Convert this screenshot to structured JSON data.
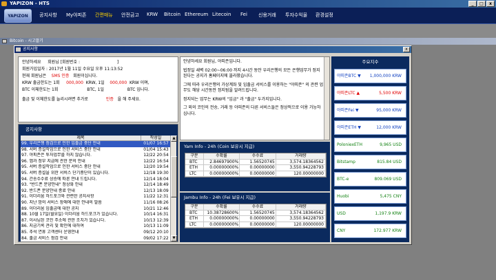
{
  "app": {
    "title": "YAPIZON - HTS",
    "logo": "YAPIZON"
  },
  "menu": [
    "공지사항",
    "My야피존",
    "간편매뉴",
    "안전금고",
    "KRW",
    "Bitcoin",
    "Ethereum",
    "Litecoin",
    "Fei",
    "신용거래",
    "투자수익율",
    "환경설정"
  ],
  "menu_active_index": 2,
  "subwindow": {
    "title": "Bitcoin - 시고팔기"
  },
  "dialog": {
    "title": "공지사항",
    "close": "x"
  },
  "greeting": {
    "l1a": "안녕하세요",
    "l1b": "회원님 [회원번호 :",
    "l1c": "]",
    "l2": "회원가입일자 :  2017년 1월 11일 수요일 오후 11:13:52",
    "l3a": "현재 회원님은",
    "l3b": "SMS 인증",
    "l3c": "회원이십니다.",
    "l4a": "KRW 출금한도는 1회",
    "l4b": "000,000",
    "l4c": "KRW, 1일",
    "l4d": "000,000",
    "l4e": "KRW 이며,",
    "l5a": "BTC 이체한도는 1회",
    "l5b": "BTC, 1일",
    "l5c": "BTC 입니다.",
    "l6a": "출금 및 이체한도를 늘리시려면 추가로",
    "l6b": "인증",
    "l6c": "을 해 주세요."
  },
  "notice": {
    "title": "공지사항",
    "col_title": "제목",
    "col_date": "작성일",
    "rows": [
      {
        "t": "99. 우리은행 점검으로 인한 입출금 중단 안내",
        "d": "01/07 16:57"
      },
      {
        "t": "98. 서버 증설작업으로 인한 서비스 중단 안내",
        "d": "01/04 15:43"
      },
      {
        "t": "97. 야피존은 투자업무를 하지 않습니다.",
        "d": "12/22 20:54"
      },
      {
        "t": "96. 앱과 정부 지급에 관한 문의 안내",
        "d": "12/22 16:54"
      },
      {
        "t": "95. 서버 증설작업으로 인한 서비스 중단 안내",
        "d": "12/20 19:54"
      },
      {
        "t": "95. 서버 증설을 위한 서비스 단기중단이 있습니다.",
        "d": "12/18 19:30"
      },
      {
        "t": "94. 간송수수료 상승에 따른 안내 드립니다.",
        "d": "12/14 18:04"
      },
      {
        "t": "93. \"반드폰 분양안내\" 정상화 안내",
        "d": "12/14 18:49"
      },
      {
        "t": "92. 반드폰 분양안내 종료 안내",
        "d": "12/13 18:09"
      },
      {
        "t": "91. 이더리움 하드포크와 관련한 공지사항",
        "d": "11/22 12:31"
      },
      {
        "t": "90. 지난 밤의 서비스 장애에 대한 안내의 말씀",
        "d": "11/16 08:26"
      },
      {
        "t": "89. 이더리움 입출금에 대한 공지",
        "d": "10/21 12:46"
      },
      {
        "t": "88. 10월 17일(월요일) 이더리움 하드포크가 있습니다.",
        "d": "10/14 16:31"
      },
      {
        "t": "87. 이사님된 코인 주소에 관한 조치가 있습니다.",
        "d": "10/13 12:39"
      },
      {
        "t": "86. 지금기록 관리 및 확인에 대하여",
        "d": "10/13 11:09"
      },
      {
        "t": "85. 추석 연휴 고객센터 운영안내",
        "d": "09/12 20:10"
      },
      {
        "t": "84. 출금 서비스 점검 안내",
        "d": "09/02 17:22"
      }
    ]
  },
  "message": [
    "안녕하세요 회원님, 야피존입니다.",
    "법정일 새벽 02:00~06:00 까지 4시간 동안 우리은행의 모든 은행업무가 정지된다는 공지가 홈페이지에 올라왔습니다.",
    "그에 따라 우리은행의 가상계좌 및 입출금 서비스를 이용하는 \"야피존\" 의 관련 업무도 해당 시간동안 정지됨을 알려드립니다.",
    "정지되는 업무는 KRW의 \"입금\" 과 \"출금\" 두가지입니다.",
    "그 외의 코인의 전송, 거래 등 야피존의 다른 서비스들은 정상적으로 이용 가능하십니다."
  ],
  "yam": {
    "title": "Yam Info - 24h  (Coin 보유시 지급)",
    "head": [
      "구분",
      "수확률",
      "수수료",
      "거래량"
    ],
    "rows": [
      [
        "BTC",
        "2.84697900%",
        "1.56520745",
        "3,574.18364562"
      ],
      [
        "ETH",
        "0.00000000%",
        "0.00000000",
        "3,550.94228793"
      ],
      [
        "LTC",
        "0.00000000%",
        "0.00000000",
        "120.00000000"
      ]
    ]
  },
  "jambu": {
    "title": "Jambu Info - 24h  (Fei 보유시 지급)",
    "head": [
      "구분",
      "수확률",
      "수수료",
      "거래량"
    ],
    "rows": [
      [
        "BTC",
        "10.38728600%",
        "1.56520745",
        "3,574.18364562"
      ],
      [
        "ETH",
        "0.00000000%",
        "0.00000000",
        "3,550.94228793"
      ],
      [
        "LTC",
        "0.00000000%",
        "0.00000000",
        "120.00000000"
      ]
    ]
  },
  "index": {
    "title": "주요지수",
    "cards": [
      {
        "name": "야피존BTC ▼",
        "value": "1,000,000 KRW",
        "color": "blue"
      },
      {
        "name": "야피존LTC ▲",
        "value": "5,500 KRW",
        "color": "red"
      },
      {
        "name": "야피존Fei ▼",
        "value": "95,000 KRW",
        "color": "blue"
      },
      {
        "name": "야피존ETH ▼",
        "value": "12,000 KRW",
        "color": "blue"
      },
      {
        "name": "PoloniexETH",
        "value": "9,965 USD",
        "color": "green"
      },
      {
        "name": "Bitstamp",
        "value": "815.84 USD",
        "color": "green"
      },
      {
        "name": "BTC-e",
        "value": "809.069 USD",
        "color": "green"
      },
      {
        "name": "Huobi",
        "value": "5,475 CNY",
        "color": "green"
      },
      {
        "name": "USD",
        "value": "1,197.9 KRW",
        "color": "green"
      },
      {
        "name": "CNY",
        "value": "172.977 KRW",
        "color": "green"
      }
    ]
  }
}
